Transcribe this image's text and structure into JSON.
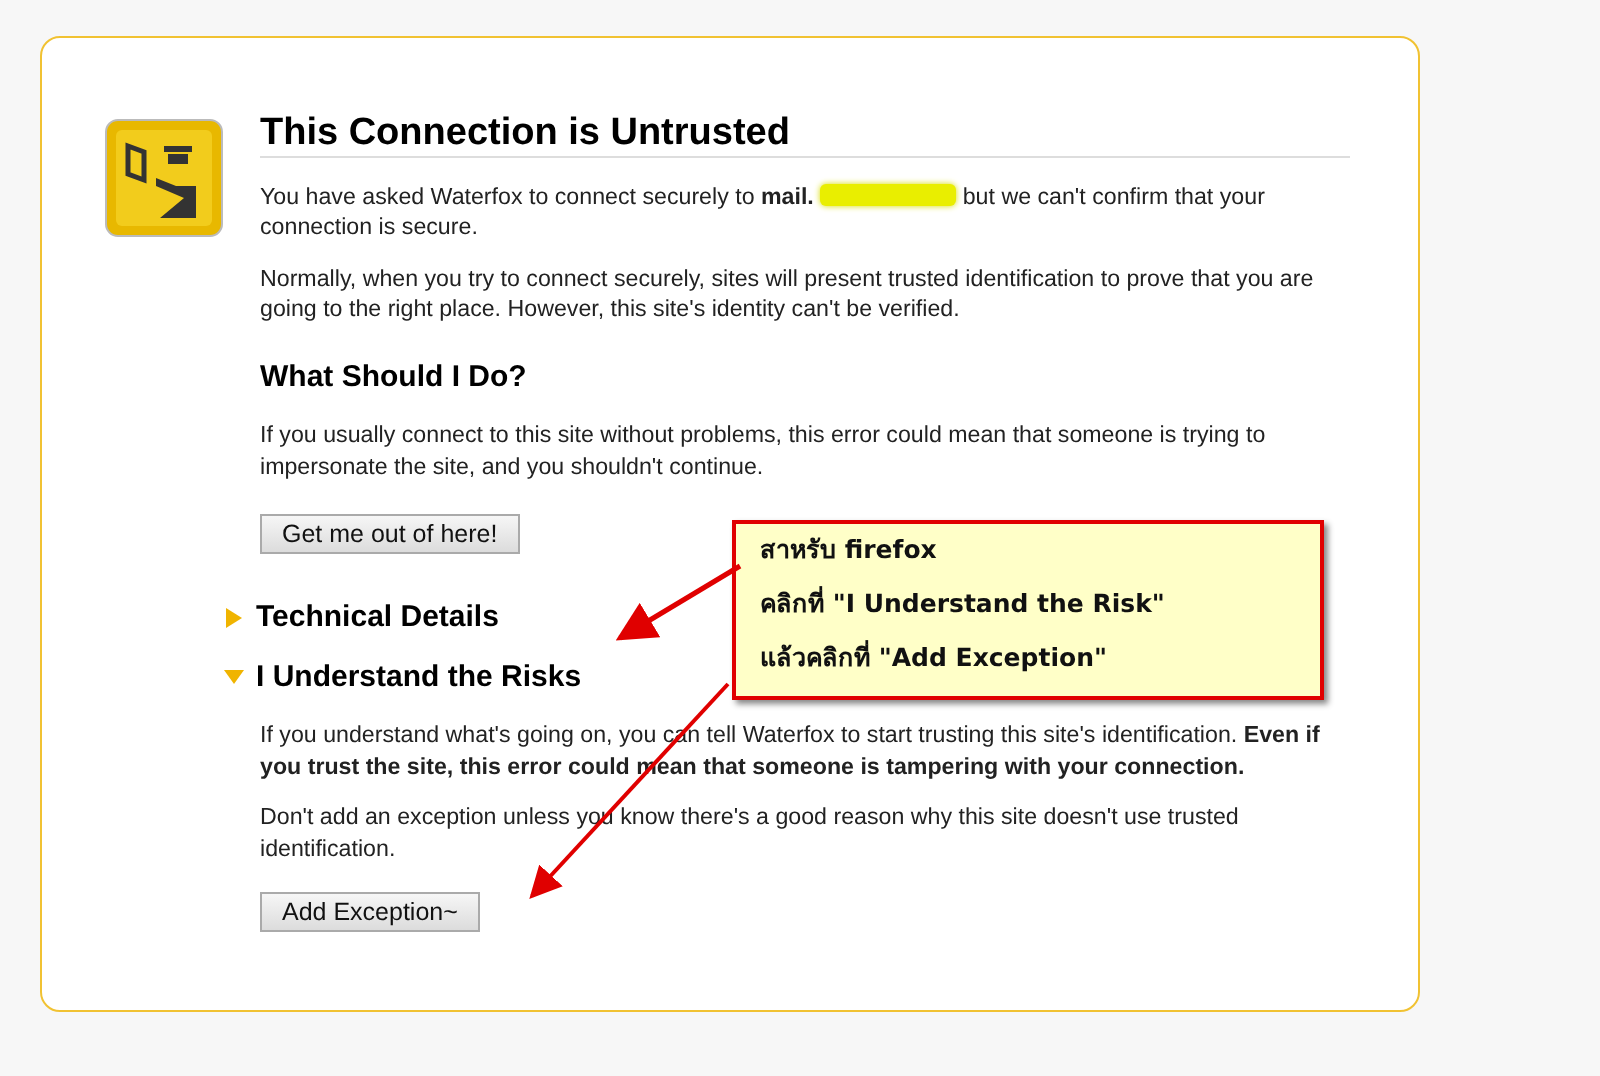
{
  "page": {
    "title": "This Connection is Untrusted",
    "intro": [
      "You have asked Waterfox to connect securely to **mail.**",
      "but we can't confirm that your connection is secure."
    ],
    "explanation": "Normally, when you try to connect securely, sites will present trusted identification to prove that you are going to the right place. However, this site's identity can't be verified.",
    "what_heading": "What Should I Do?",
    "what_text": "If you usually connect to this site without problems, this error could mean that someone is trying to impersonate the site, and you shouldn't continue.",
    "escape_button": "Get me out of here!",
    "sections": [
      {
        "heading": "Technical Details",
        "expanded": false
      },
      {
        "heading": "I Understand the Risks",
        "expanded": true,
        "paragraphs": [
          "If you understand what's going on, you can tell Waterfox to start trusting this site's identification. **Even if you trust the site, this error could mean that someone is tampering with your connection.**",
          "Don't add an exception unless you know there's a good reason why this site doesn't use trusted identification."
        ],
        "button": "Add Exception~"
      }
    ]
  },
  "callout": {
    "lines": [
      "สาหรับ firefox",
      "คลิกที่ \"I Understand the Risk\"",
      "แล้วคลิกที่ \"Add Exception\""
    ]
  }
}
